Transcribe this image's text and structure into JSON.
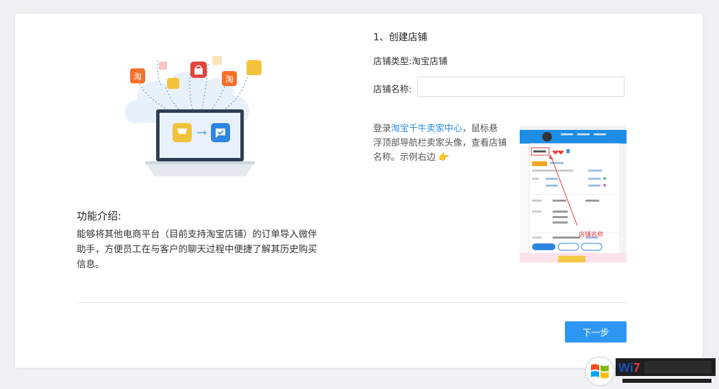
{
  "intro": {
    "title": "功能介绍:",
    "body": "能够将其他电商平台（目前支持淘宝店铺）的订单导入微伴助手，方便员工在与客户的聊天过程中便捷了解其历史购买信息。"
  },
  "illustration": {
    "tao_badge_left": "淘",
    "tao_badge_right": "淘"
  },
  "form": {
    "step_title": "1、创建店铺",
    "store_type_label": "店铺类型:",
    "store_type_value": "淘宝店铺",
    "store_name_label": "店铺名称:",
    "store_name_value": "",
    "store_name_placeholder": ""
  },
  "tip": {
    "prefix": "登录",
    "link": "淘宝千牛卖家中心",
    "suffix": "，鼠标悬浮顶部导航栏卖家头像，查看店铺名称。示例右边",
    "emoji": "👉"
  },
  "example": {
    "annotation": "店铺名称"
  },
  "footer": {
    "next_label": "下一步"
  },
  "watermark": {
    "text_a": "Wi",
    "text_b": "7"
  },
  "colors": {
    "primary": "#2e96f5",
    "link": "#2a8ee8",
    "annotation_red": "#e5383b",
    "tao_orange": "#f5702a",
    "cart_yellow": "#f2c23c",
    "bag_red": "#e0473a"
  }
}
